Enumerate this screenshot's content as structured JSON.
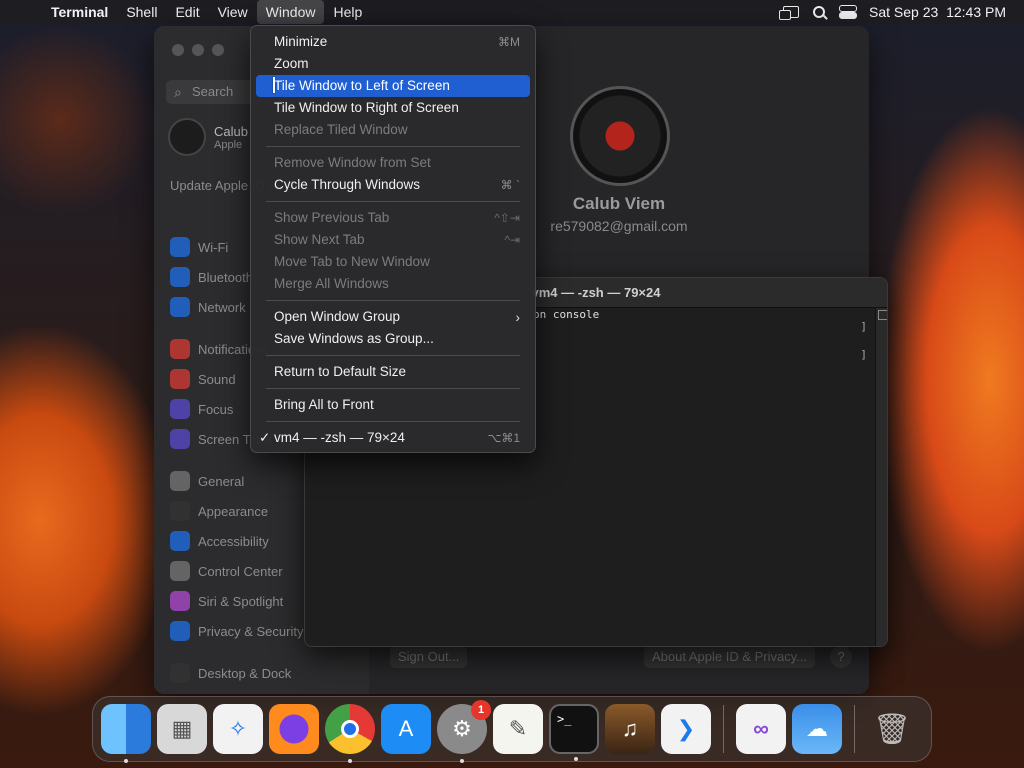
{
  "menubar": {
    "app_name": "Terminal",
    "menus": [
      "Shell",
      "Edit",
      "View",
      "Window",
      "Help"
    ],
    "active_menu": "Window",
    "datetime": "Sat Sep 23  12:43 PM"
  },
  "window_menu": {
    "items": [
      {
        "label": "Minimize",
        "shortcut": "⌘M",
        "disabled": false
      },
      {
        "label": "Zoom",
        "shortcut": "",
        "disabled": false
      },
      {
        "label": "Tile Window to Left of Screen",
        "shortcut": "",
        "disabled": false,
        "selected": true
      },
      {
        "label": "Tile Window to Right of Screen",
        "shortcut": "",
        "disabled": false
      },
      {
        "label": "Replace Tiled Window",
        "shortcut": "",
        "disabled": true
      },
      {
        "label": "Remove Window from Set",
        "shortcut": "",
        "disabled": true
      },
      {
        "label": "Cycle Through Windows",
        "shortcut": "⌘ `",
        "disabled": false
      },
      {
        "label": "Show Previous Tab",
        "shortcut": "^⇧⇥",
        "disabled": true
      },
      {
        "label": "Show Next Tab",
        "shortcut": "^⇥",
        "disabled": true
      },
      {
        "label": "Move Tab to New Window",
        "shortcut": "",
        "disabled": true
      },
      {
        "label": "Merge All Windows",
        "shortcut": "",
        "disabled": true
      },
      {
        "label": "Open Window Group",
        "shortcut": "",
        "disabled": false
      },
      {
        "label": "Save Windows as Group...",
        "shortcut": "",
        "disabled": false
      },
      {
        "label": "Return to Default Size",
        "shortcut": "",
        "disabled": false
      },
      {
        "label": "Bring All to Front",
        "shortcut": "",
        "disabled": false
      },
      {
        "label": "vm4 — -zsh — 79×24",
        "shortcut": "⌥⌘1",
        "disabled": false,
        "checked": true
      }
    ]
  },
  "terminal": {
    "title": "vm4 — -zsh — 79×24",
    "line1": "on console"
  },
  "settings": {
    "search_placeholder": "Search",
    "account_name": "Calub",
    "account_sub": "Apple",
    "update_text": "Update Apple ID Settings",
    "sidebar": [
      "Wi-Fi",
      "Bluetooth",
      "Network",
      "Notifications",
      "Sound",
      "Focus",
      "Screen Time",
      "General",
      "Appearance",
      "Accessibility",
      "Control Center",
      "Siri & Spotlight",
      "Privacy & Security",
      "Desktop & Dock"
    ],
    "user_name": "Calub Viem",
    "user_email": "re579082@gmail.com",
    "sign_out": "Sign Out...",
    "about": "About Apple ID & Privacy...",
    "help": "?"
  },
  "dock": {
    "apps": [
      "Finder",
      "Launchpad",
      "Safari",
      "Firefox",
      "Chrome",
      "App Store",
      "System Settings",
      "TextEdit",
      "Terminal",
      "GarageBand",
      "VS Code",
      "Visual Studio",
      "Weather",
      "Trash"
    ],
    "settings_badge": "1"
  },
  "colors": {
    "menu_highlight": "#1f5fd1",
    "badge": "#e8352c"
  }
}
